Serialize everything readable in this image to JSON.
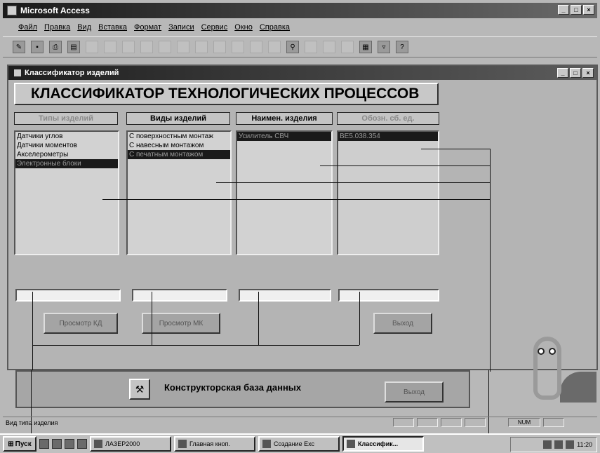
{
  "app": {
    "title": "Microsoft Access",
    "window_buttons": [
      "_",
      "□",
      "×"
    ]
  },
  "menu": [
    "Файл",
    "Правка",
    "Вид",
    "Вставка",
    "Формат",
    "Записи",
    "Сервис",
    "Окно",
    "Справка"
  ],
  "toolbar": {
    "icons": [
      "design-view-icon",
      "save-icon",
      "print-icon",
      "print-preview-icon",
      "spelling-icon",
      "cut-icon",
      "copy-icon",
      "paste-icon",
      "format-painter-icon",
      "undo-icon",
      "insert-hyperlink-icon",
      "sort-ascending-icon",
      "sort-descending-icon",
      "filter-by-selection-icon",
      "apply-filter-icon",
      "find-icon",
      "new-record-icon",
      "delete-record-icon",
      "properties-icon",
      "database-window-icon",
      "new-object-icon",
      "help-icon"
    ]
  },
  "form": {
    "window_title": "Классификатор изделий",
    "header": "КЛАССИФИКАТОР ТЕХНОЛОГИЧЕСКИХ ПРОЦЕССОВ",
    "columns": [
      {
        "label": "Типы изделий"
      },
      {
        "label": "Виды изделий"
      },
      {
        "label": "Наимен. изделия"
      },
      {
        "label": "Обозн. сб. ед."
      }
    ],
    "list_types": [
      "Датчики углов",
      "Датчики моментов",
      "Акселерометры",
      "Электронные блоки"
    ],
    "list_types_selected": 3,
    "list_kinds": [
      "С поверхностным монтаж",
      "С навесным монтажом",
      "С печатным монтажом"
    ],
    "list_kinds_selected": 2,
    "list_names": [
      "Усилитель СВЧ"
    ],
    "list_designations": [
      "ВЕ5.038.354"
    ],
    "buttons": {
      "view_kd": "Просмотр КД",
      "view_mk": "Просмотр МК",
      "exit": "Выход"
    }
  },
  "switchboard": {
    "title": "Конструкторская база данных",
    "exit": "Выход"
  },
  "statusbar": {
    "text": "Вид типа изделия",
    "num": "NUM"
  },
  "taskbar": {
    "start": "Пуск",
    "tasks": [
      "ЛАЗЕР2000",
      "Главная кноп.",
      "Создание Ехс",
      "Классифик..."
    ],
    "active_index": 3,
    "clock": "11:20"
  }
}
